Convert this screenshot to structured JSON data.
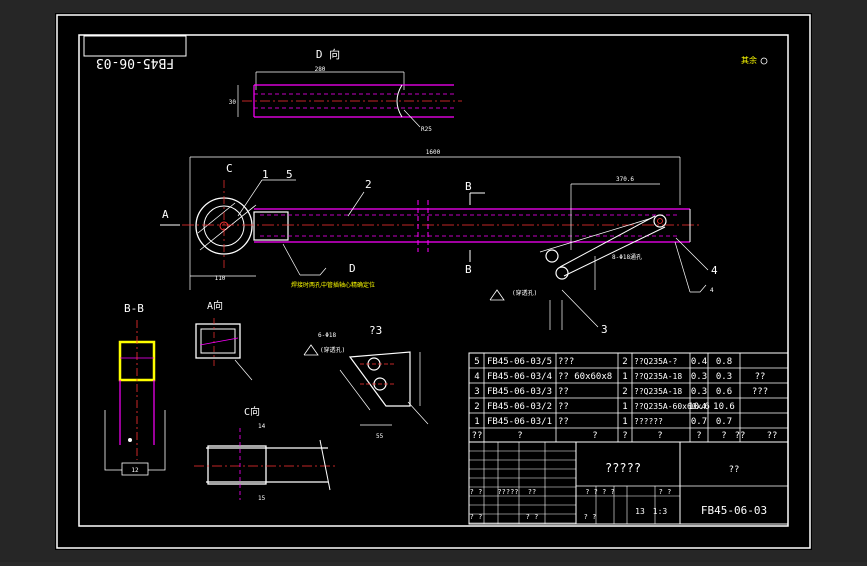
{
  "drawing": {
    "number_mirrored": "FB45-06-03",
    "roughness_note": "其余",
    "bottom_note": "焊接时两孔中管插轴心精确定位"
  },
  "views": {
    "view_d": "D 向",
    "section_a": "A",
    "section_b": "B",
    "section_c": "C",
    "section_d": "D",
    "bb_title": "B-B",
    "a_dir": "A向",
    "c_dir": "C向",
    "detail_3": "?3"
  },
  "dims": {
    "d_len": "280",
    "d_h": "30",
    "d_r": "R25",
    "main_len": "1600",
    "left_h": "110",
    "right_len": "370.6",
    "slot": "8-Φ18通孔",
    "through": "(穿透孔)",
    "b_dim": "12",
    "c_dim1": "14",
    "c_dim2": "15",
    "det_dim1": "6-Φ18",
    "det_dim2": "55",
    "det_through": "(穿透孔)",
    "rough4": "4"
  },
  "balloons": [
    "1",
    "2",
    "3",
    "4",
    "5"
  ],
  "bom": {
    "rows": [
      {
        "no": "5",
        "code": "FB45-06-03/5",
        "name": "???",
        "spec": "",
        "qty": "2",
        "mat": "??Q235A-?",
        "w1": "0.4",
        "w2": "0.8",
        "note": ""
      },
      {
        "no": "4",
        "code": "FB45-06-03/4",
        "name": "??",
        "spec": "60x60x8",
        "qty": "1",
        "mat": "??Q235A-18",
        "w1": "0.3",
        "w2": "0.3",
        "note": "??"
      },
      {
        "no": "3",
        "code": "FB45-06-03/3",
        "name": "??",
        "spec": "",
        "qty": "2",
        "mat": "??Q235A-18",
        "w1": "0.3",
        "w2": "0.6",
        "note": "???"
      },
      {
        "no": "2",
        "code": "FB45-06-03/2",
        "name": "??",
        "spec": "",
        "qty": "1",
        "mat": "??Q235A-60x60x4",
        "w1": "10.6",
        "w2": "10.6",
        "note": ""
      },
      {
        "no": "1",
        "code": "FB45-06-03/1",
        "name": "??",
        "spec": "",
        "qty": "1",
        "mat": "??????",
        "w1": "0.7",
        "w2": "0.7",
        "note": ""
      }
    ],
    "header": {
      "no": "??",
      "code": "?",
      "name": "?",
      "spec": "?",
      "qty": "?",
      "mat": "?",
      "w1": "?",
      "w2": "?",
      "w2b": "??",
      "note": "??"
    }
  },
  "title_block": {
    "title": "?????",
    "unit": "??",
    "number": "FB45-06-03",
    "scale": "1:3",
    "sheets": "13",
    "c_a": "? ?",
    "c_b": "?????",
    "c_c": "??",
    "c_d": "? ? ? ?",
    "c_e": "? ?",
    "c_f": "? ?",
    "c_g": "? ?",
    "c_h": "? ?"
  }
}
